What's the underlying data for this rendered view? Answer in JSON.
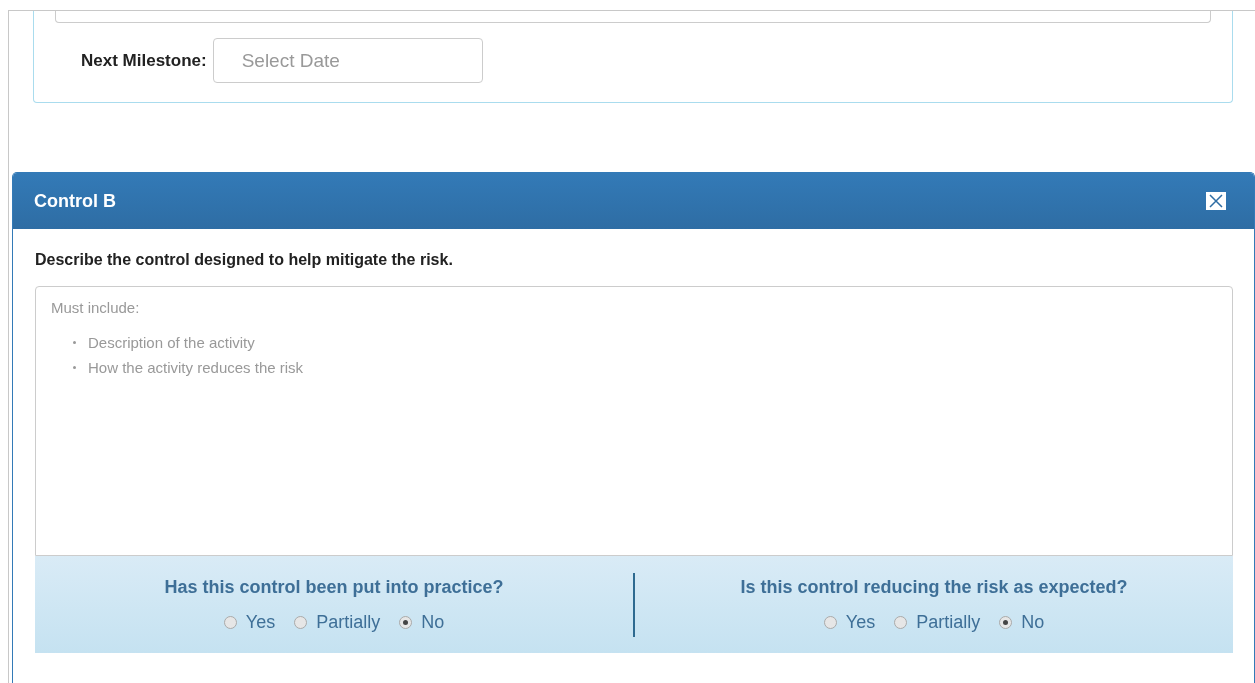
{
  "milestone": {
    "label": "Next Milestone:",
    "placeholder": "Select Date"
  },
  "panel": {
    "title": "Control B",
    "prompt": "Describe the control designed to help mitigate the risk.",
    "description": {
      "heading": "Must include:",
      "items": [
        "Description of the activity",
        "How the activity reduces the risk"
      ]
    },
    "questions": [
      {
        "text": "Has this control been put into practice?",
        "options": [
          {
            "label": "Yes",
            "selected": false
          },
          {
            "label": "Partially",
            "selected": false
          },
          {
            "label": "No",
            "selected": true
          }
        ]
      },
      {
        "text": "Is this control reducing the risk as expected?",
        "options": [
          {
            "label": "Yes",
            "selected": false
          },
          {
            "label": "Partially",
            "selected": false
          },
          {
            "label": "No",
            "selected": true
          }
        ]
      }
    ]
  }
}
